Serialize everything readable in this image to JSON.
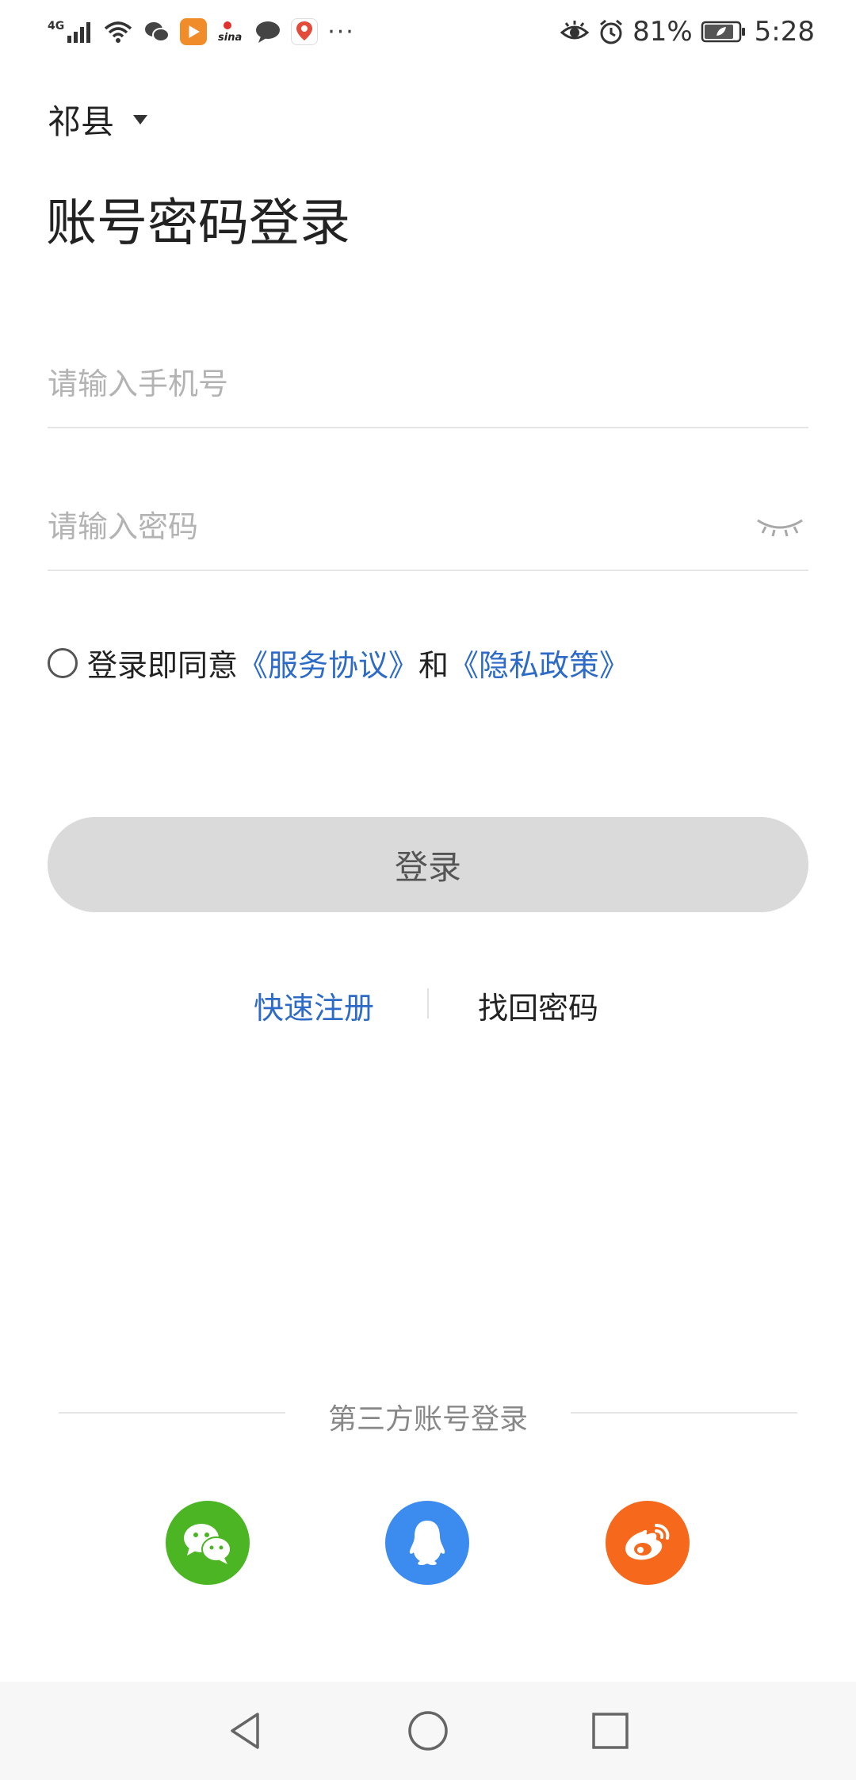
{
  "status_bar": {
    "network": "4G",
    "battery": "81%",
    "time": "5:28",
    "more": "···",
    "icons": [
      "signal-icon",
      "wifi-icon",
      "wechat-notification-icon",
      "video-app-icon",
      "sina-icon",
      "message-icon",
      "map-pin-app-icon",
      "eye-comfort-icon",
      "alarm-icon",
      "battery-icon"
    ]
  },
  "location": {
    "city": "祁县"
  },
  "title": "账号密码登录",
  "phone": {
    "placeholder": "请输入手机号",
    "value": ""
  },
  "password": {
    "placeholder": "请输入密码",
    "value": ""
  },
  "agreement": {
    "prefix": "登录即同意",
    "terms": "《服务协议》",
    "and": "和",
    "privacy": "《隐私政策》",
    "checked": false
  },
  "login_button": "登录",
  "links": {
    "register": "快速注册",
    "forgot": "找回密码"
  },
  "third_party": {
    "label": "第三方账号登录",
    "providers": [
      "wechat",
      "qq",
      "weibo"
    ]
  },
  "colors": {
    "link": "#2d6bc7",
    "button_disabled": "#dadada",
    "wechat": "#4cb524",
    "qq": "#3c8bef",
    "weibo": "#f6691c"
  }
}
